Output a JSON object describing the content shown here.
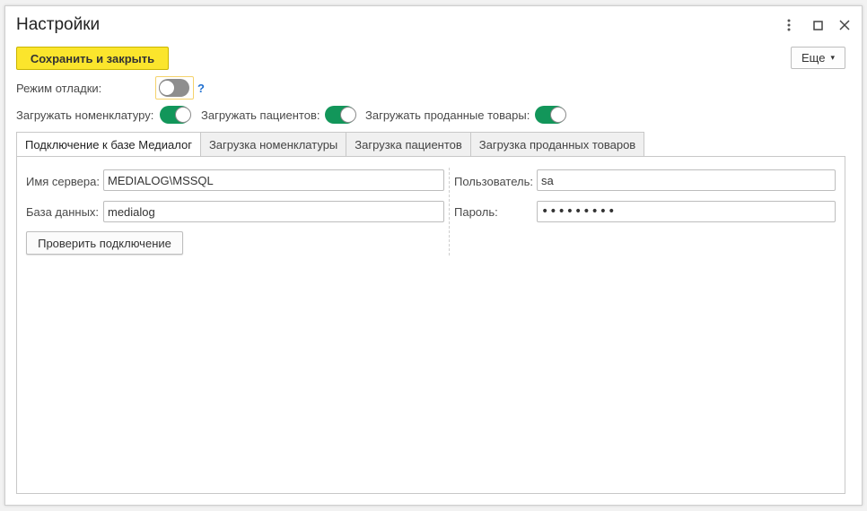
{
  "window": {
    "title": "Настройки",
    "controls": {
      "menu": "⋮",
      "maximize": "□",
      "close": "✕"
    }
  },
  "toolbar": {
    "save_label": "Сохранить и закрыть",
    "more_label": "Еще",
    "more_arrow": "▾"
  },
  "debug": {
    "label": "Режим отладки:",
    "enabled": false,
    "help": "?"
  },
  "loaders": [
    {
      "label": "Загружать номенклатуру:",
      "enabled": true
    },
    {
      "label": "Загружать пациентов:",
      "enabled": true
    },
    {
      "label": "Загружать проданные товары:",
      "enabled": true
    }
  ],
  "tabs": [
    {
      "label": "Подключение к базе Медиалог",
      "active": true
    },
    {
      "label": "Загрузка номенклатуры",
      "active": false
    },
    {
      "label": "Загрузка пациентов",
      "active": false
    },
    {
      "label": "Загрузка проданных товаров",
      "active": false
    }
  ],
  "connection": {
    "server_label": "Имя сервера:",
    "server_value": "MEDIALOG\\MSSQL",
    "db_label": "База данных:",
    "db_value": "medialog",
    "user_label": "Пользователь:",
    "user_value": "sa",
    "password_label": "Пароль:",
    "password_value": "•••••••••",
    "check_button": "Проверить подключение"
  },
  "colors": {
    "accent_yellow": "#fbe52c",
    "toggle_on": "#12965a",
    "toggle_off": "#8e8e8e",
    "help_link": "#1f6fd0"
  }
}
